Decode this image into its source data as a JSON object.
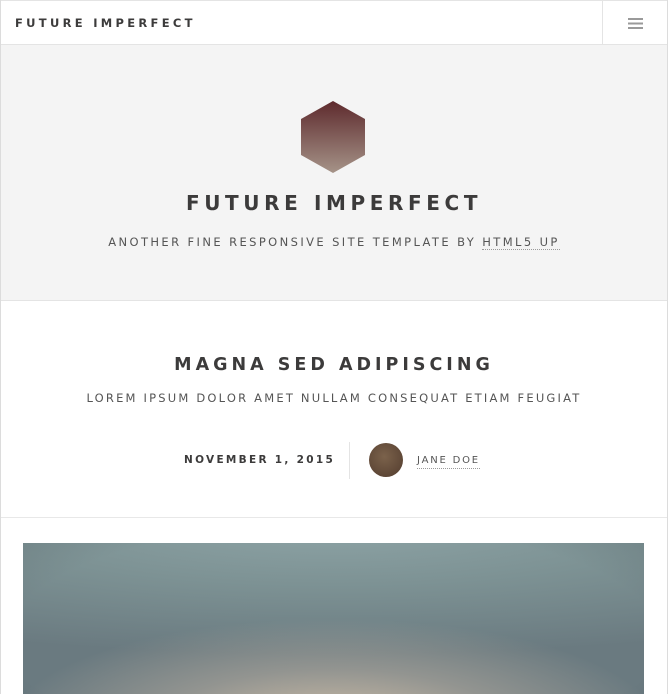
{
  "header": {
    "brand": "FUTURE IMPERFECT",
    "menu_icon": "hamburger-icon"
  },
  "intro": {
    "logo_icon": "hexagon-logo",
    "title": "FUTURE IMPERFECT",
    "subtitle_prefix": "ANOTHER FINE RESPONSIVE SITE TEMPLATE BY ",
    "subtitle_link": "HTML5 UP"
  },
  "post": {
    "title": "MAGNA SED ADIPISCING",
    "subtitle": "LOREM IPSUM DOLOR AMET NULLAM CONSEQUAT ETIAM FEUGIAT",
    "date": "NOVEMBER 1, 2015",
    "author": "JANE DOE",
    "featured_image": "blurred-landscape-image"
  },
  "colors": {
    "text": "#3c3b3b",
    "intro_bg": "#f4f4f4",
    "border": "#e4e4e4",
    "logo_top": "#5e2a2d",
    "logo_bottom": "#a59388"
  }
}
